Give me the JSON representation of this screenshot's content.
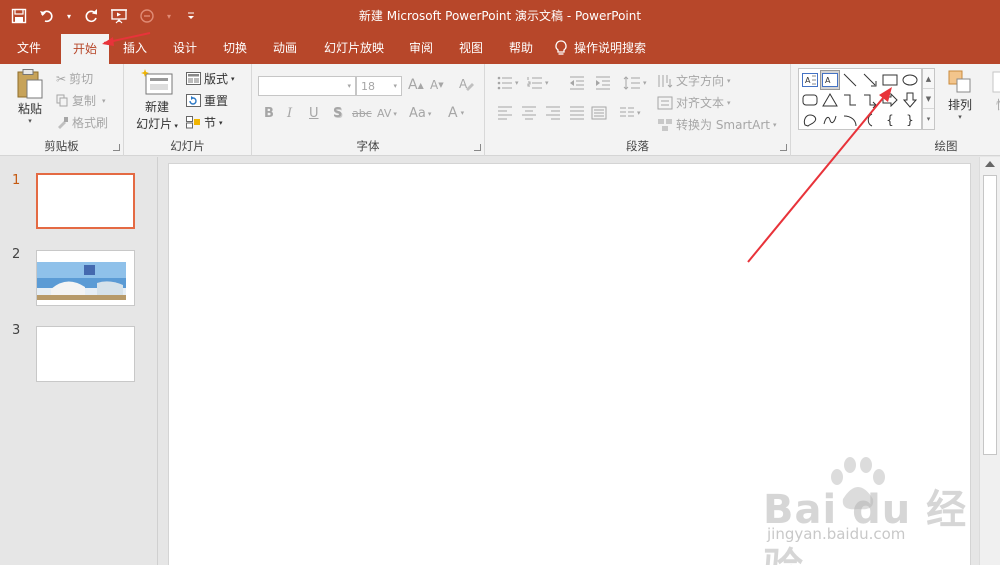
{
  "window": {
    "title": "新建 Microsoft PowerPoint 演示文稿 - PowerPoint",
    "accent": "#b7472a"
  },
  "qat": {
    "icons": [
      "save-icon",
      "undo-icon",
      "redo-icon",
      "start-slideshow-icon",
      "touch-mode-icon",
      "customize-qat-icon"
    ]
  },
  "tabs": [
    {
      "label": "文件",
      "active": false
    },
    {
      "label": "开始",
      "active": true
    },
    {
      "label": "插入",
      "active": false
    },
    {
      "label": "设计",
      "active": false
    },
    {
      "label": "切换",
      "active": false
    },
    {
      "label": "动画",
      "active": false
    },
    {
      "label": "幻灯片放映",
      "active": false
    },
    {
      "label": "审阅",
      "active": false
    },
    {
      "label": "视图",
      "active": false
    },
    {
      "label": "帮助",
      "active": false
    },
    {
      "label": "操作说明搜索",
      "active": false
    }
  ],
  "ribbon": {
    "clipboard": {
      "label": "剪贴板",
      "paste": "粘贴",
      "cut": "剪切",
      "copy": "复制",
      "format_painter": "格式刷"
    },
    "slides": {
      "label": "幻灯片",
      "new_slide_line1": "新建",
      "new_slide_line2": "幻灯片",
      "layout": "版式",
      "reset": "重置",
      "section": "节"
    },
    "font": {
      "label": "字体",
      "font_name": "",
      "font_size": "18",
      "bold": "B",
      "italic": "I",
      "underline": "U",
      "shadow": "S",
      "strike": "abc",
      "spacing": "AV",
      "case": "Aa",
      "color": "A",
      "grow": "A",
      "shrink": "A"
    },
    "paragraph": {
      "label": "段落",
      "text_direction": "文字方向",
      "align_text": "对齐文本",
      "smartart": "转换为 SmartArt"
    },
    "drawing": {
      "label": "绘图",
      "arrange": "排列",
      "quick_styles": "快"
    }
  },
  "slides": [
    {
      "number": "1",
      "active": true
    },
    {
      "number": "2",
      "active": false
    },
    {
      "number": "3",
      "active": false
    }
  ],
  "watermark": {
    "logo": "Bai du 经验",
    "url": "jingyan.baidu.com"
  }
}
